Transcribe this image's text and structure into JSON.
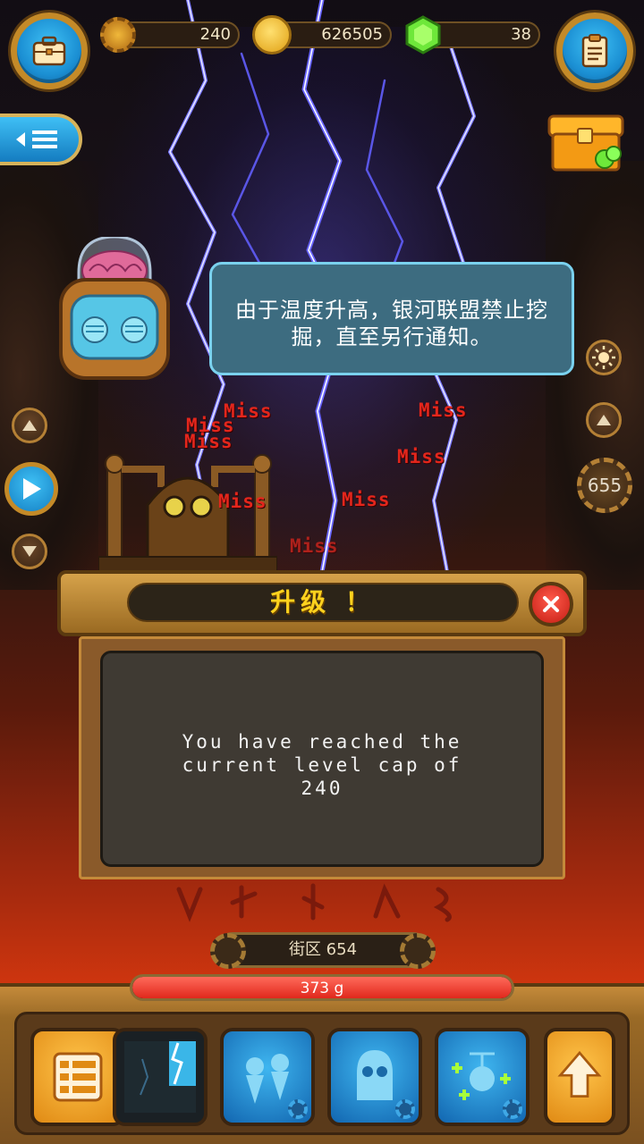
{
  "resources": {
    "gears": "240",
    "coins": "626505",
    "gems": "38"
  },
  "notice": {
    "text": "由于温度升高，银河联盟禁止挖掘，直至另行通知。"
  },
  "depth_counter": "655",
  "combat_texts": [
    "Miss",
    "Miss",
    "Miss",
    "Miss",
    "Miss",
    "Miss",
    "Miss",
    "Miss"
  ],
  "dialog": {
    "title": "升级 ！",
    "message": "You have reached the current level cap of 240"
  },
  "district": {
    "label": "街区 654"
  },
  "progress": {
    "label": "373 g",
    "fraction": 1.0
  },
  "icons": {
    "briefcase": "briefcase-icon",
    "clipboard": "clipboard-icon",
    "gear": "gear-icon",
    "coin": "coin-icon",
    "gem": "gem-icon",
    "menu": "menu-list-icon",
    "chest": "treasure-chest-icon",
    "sun": "sun-icon",
    "up": "chevron-up-icon",
    "down": "chevron-down-icon",
    "play": "play-icon",
    "close": "close-icon",
    "list": "list-icon",
    "lightning": "lightning-skill-icon",
    "drill": "drill-robots-icon",
    "robot": "robot-skill-icon",
    "drone": "drone-skill-icon",
    "upgrade": "upgrade-arrow-icon"
  },
  "colors": {
    "accent_blue": "#1b8fd3",
    "frame_gold": "#c48a28",
    "miss_red": "#e3261c",
    "title_yellow": "#ffd21e"
  }
}
